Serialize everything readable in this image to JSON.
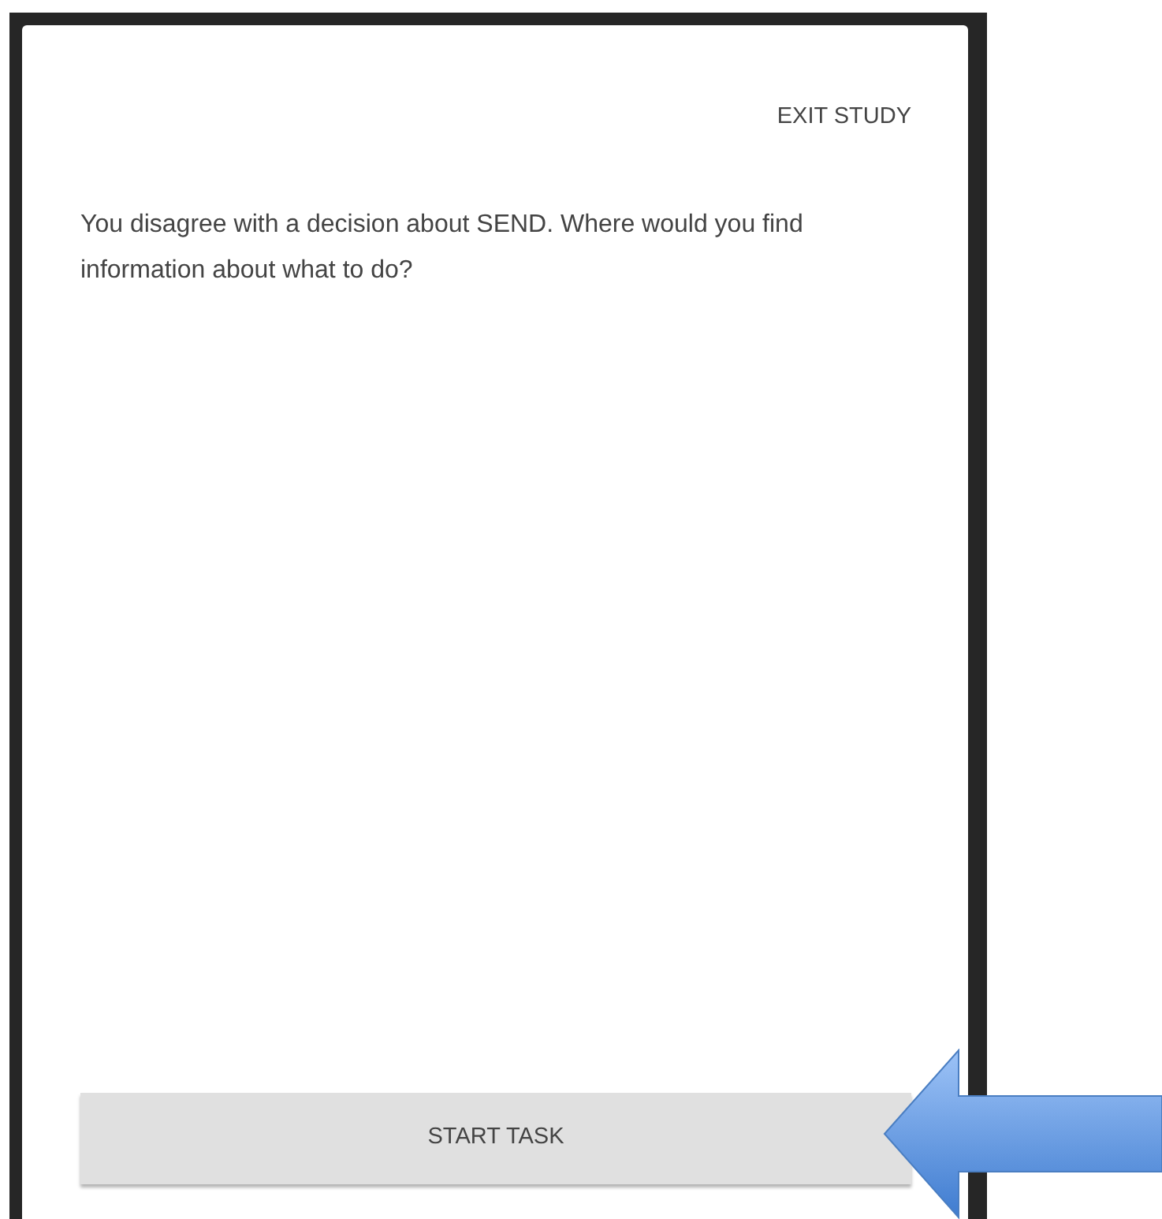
{
  "modal": {
    "exit_link": "EXIT STUDY",
    "question": "You disagree with a decision about SEND. Where would you find information about what to do?",
    "start_button": "START TASK"
  }
}
